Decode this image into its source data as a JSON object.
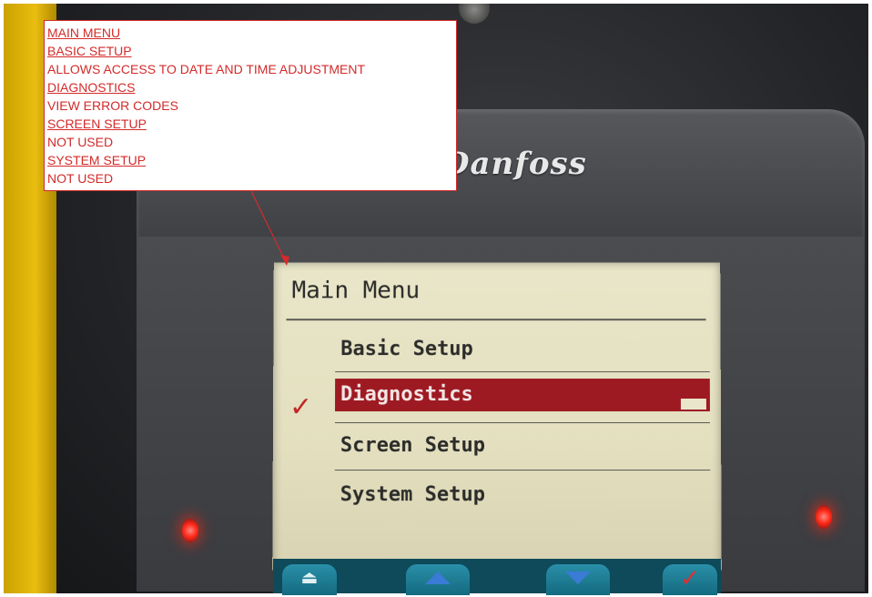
{
  "callout": {
    "lines": [
      {
        "text": "MAIN MENU",
        "link": true
      },
      {
        "text": "BASIC SETUP",
        "link": true
      },
      {
        "text": "ALLOWS ACCESS TO DATE AND TIME ADJUSTMENT",
        "link": false
      },
      {
        "text": "DIAGNOSTICS",
        "link": true
      },
      {
        "text": "VIEW ERROR CODES",
        "link": false
      },
      {
        "text": "SCREEN SETUP",
        "link": true
      },
      {
        "text": "NOT USED",
        "link": false
      },
      {
        "text": "SYSTEM SETUP",
        "link": true
      },
      {
        "text": "NOT USED",
        "link": false
      }
    ],
    "color": "#d42a2a"
  },
  "device": {
    "brand": "Danfoss"
  },
  "lcd": {
    "title": "Main Menu",
    "items": [
      {
        "label": "Basic Setup",
        "selected": false
      },
      {
        "label": "Diagnostics",
        "selected": true
      },
      {
        "label": "Screen Setup",
        "selected": false
      },
      {
        "label": "System Setup",
        "selected": false
      }
    ],
    "selection_marker": "✓",
    "highlight_color": "#9e1a22"
  },
  "softkeys": [
    {
      "icon": "exit-icon",
      "glyph": "⏏"
    },
    {
      "icon": "arrow-up-icon",
      "glyph": ""
    },
    {
      "icon": "arrow-down-icon",
      "glyph": ""
    },
    {
      "icon": "check-icon",
      "glyph": "✓"
    }
  ]
}
